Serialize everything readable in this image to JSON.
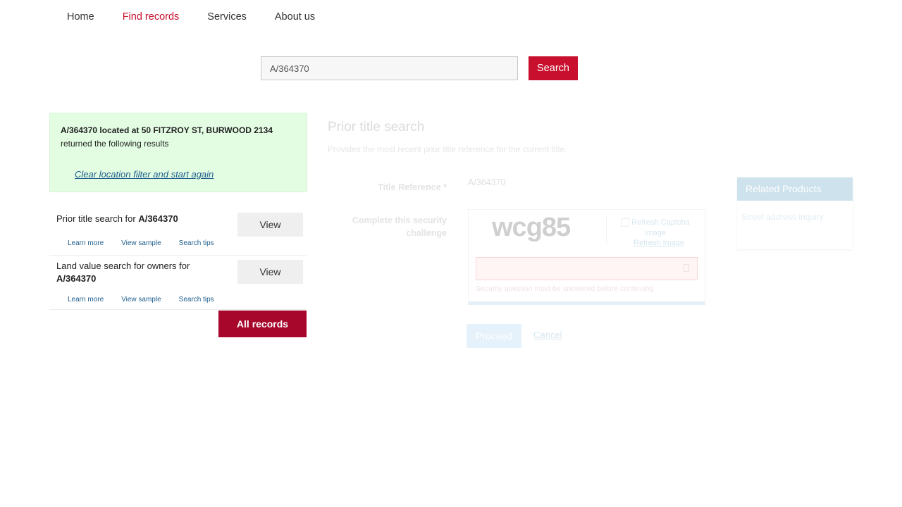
{
  "nav": {
    "items": [
      {
        "label": "Home"
      },
      {
        "label": "Find records"
      },
      {
        "label": "Services"
      },
      {
        "label": "About us"
      }
    ],
    "active_index": 1
  },
  "search": {
    "value": "A/364370",
    "button_label": "Search"
  },
  "location_box": {
    "line1": "A/364370 located at 50 FITZROY ST, BURWOOD 2134",
    "line2": "returned the following results",
    "clear_link": "Clear location filter and start again"
  },
  "results": [
    {
      "title_prefix": "Prior title search for ",
      "title_ref": "A/364370",
      "view_label": "View",
      "links": [
        "Learn more",
        "View sample",
        "Search tips"
      ]
    },
    {
      "title_prefix": "Land value search for owners for ",
      "title_ref": "A/364370",
      "view_label": "View",
      "links": [
        "Learn more",
        "View sample",
        "Search tips"
      ]
    }
  ],
  "all_records_label": "All records",
  "product_form": {
    "title": "Prior title search",
    "description": "Provides the most recent prior title reference for the current title.",
    "title_reference_label": "Title Reference *",
    "title_reference_value": "A/364370",
    "security_label_line1": "Complete this security",
    "security_label_line2": "challenge",
    "captcha_text": "wcg85",
    "refresh_captcha_alt_line1": "Refresh Captcha",
    "refresh_captcha_alt_line2": "image",
    "refresh_image_link": "Refresh Image",
    "captcha_error": "Security question must be answered before continuing",
    "proceed_label": "Proceed",
    "cancel_label": "Cancel"
  },
  "related_products": {
    "heading": "Related Products",
    "items": [
      "Street address inquiry"
    ]
  },
  "colors": {
    "brand_red": "#c8102e",
    "all_records_red": "#a6072b",
    "location_box_bg": "#e3fde3",
    "link_blue": "#1f5d8c"
  }
}
